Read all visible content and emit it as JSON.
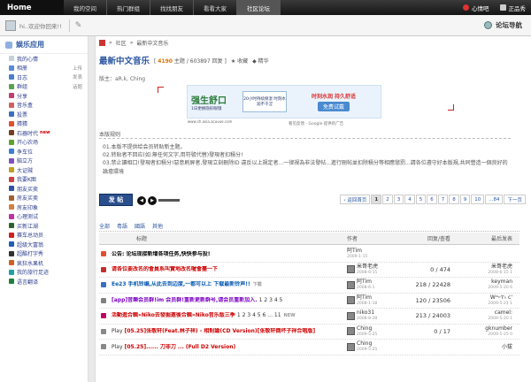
{
  "topnav": {
    "home": "Home",
    "items": [
      "我的空间",
      "热门群组",
      "找找朋友",
      "看看大家",
      "社区论坛"
    ],
    "active": 4,
    "right": [
      "心情吧",
      "正品秀"
    ]
  },
  "userbar": {
    "welcome": "hi..欢迎你回来!!",
    "forum_nav": "论坛导航"
  },
  "sidebar": {
    "title": "娱乐应用",
    "items": [
      {
        "label": "我的心情",
        "color": "#c5d0da"
      },
      {
        "label": "相册",
        "extra": "上传",
        "color": "#5b8bd5"
      },
      {
        "label": "日志",
        "extra": "发表",
        "color": "#4a7fc8"
      },
      {
        "label": "群组",
        "extra": "话题",
        "color": "#5aa050"
      },
      {
        "label": "分享",
        "color": "#c04070"
      },
      {
        "label": "音乐盒",
        "color": "#d06060"
      },
      {
        "label": "投票",
        "color": "#3a70c0"
      },
      {
        "label": "猜猜",
        "color": "#e05030"
      },
      {
        "label": "石器时代",
        "new": "new",
        "color": "#704020"
      },
      {
        "label": "开心农场",
        "color": "#60a030"
      },
      {
        "label": "争车位",
        "color": "#3a80d0"
      },
      {
        "label": "脑立方",
        "color": "#8050c0"
      },
      {
        "label": "大证贼",
        "color": "#c0a020"
      },
      {
        "label": "我要K图",
        "color": "#d04040"
      },
      {
        "label": "朋友买卖",
        "color": "#3050a0"
      },
      {
        "label": "房友买卖",
        "color": "#a06030"
      },
      {
        "label": "房友印象",
        "color": "#d08040"
      },
      {
        "label": "心理测试",
        "color": "#c030a0"
      },
      {
        "label": "买新江湖",
        "color": "#306030"
      },
      {
        "label": "赛车总动员",
        "color": "#d02020"
      },
      {
        "label": "超级大富翁",
        "color": "#2060b0"
      },
      {
        "label": "超酷打字秀",
        "color": "#303030"
      },
      {
        "label": "疯狂水果机",
        "color": "#d06020"
      },
      {
        "label": "我的旅行足迹",
        "color": "#20a0a0"
      },
      {
        "label": "语言翻译",
        "color": "#208040"
      }
    ]
  },
  "breadcrumb": {
    "a": "社区",
    "b": "最新中文音乐"
  },
  "forum": {
    "name": "最新中文音乐",
    "topics": "4190",
    "topics_label": "主题",
    "posts": "/ 603897 回复",
    "collect": "收藏",
    "digest": "精华",
    "moderators": "版主：aR.k, Ching"
  },
  "ad": {
    "brand": "强生舒口",
    "slogan": "1日更换隐形眼镜",
    "mid": "20小时持续保湿 时刻水润不干涩",
    "right1": "时刻水润 持久舒适",
    "right2": "免费试戴",
    "url": "www.ch.asia.acuvue.com",
    "by": "看见反馈 - Google 提供的广告"
  },
  "rules": {
    "heading": "本版规则",
    "lines": [
      "01.本版不提供给会员转贴新主题。",
      "02.转贴者不回应(如:無任何文字,用符號代替)發現者扣積分!",
      "03.禁止讀相口!發現者扣積分!惡意刷屏者,發現立刻刪除ID 違反以上規定者...一律視為非法發帖...進行刪帖並扣除積分等相應懲罰...請各位遵守好本版規,共同營造一個良好的論壇環境"
    ]
  },
  "post_button": "发 帖",
  "pager": {
    "prev": "‹ 返回首页",
    "pages": [
      "1",
      "2",
      "3",
      "4",
      "5",
      "6",
      "7",
      "8",
      "9",
      "10",
      "...84"
    ],
    "current": "1",
    "next": "下一页"
  },
  "filter_tabs": [
    "全部",
    "粤語",
    "國語",
    "其他"
  ],
  "table": {
    "headers": [
      "标题",
      "作者",
      "回复/查看",
      "最后发表"
    ],
    "rows": [
      {
        "title": "公告: 论坛现接新增各项任务,快快参与投!",
        "style": "t-announce",
        "author": "阿Tim",
        "adate": "2009-1-15",
        "stats": "",
        "last": "",
        "ldate": "",
        "icon": "#e05030",
        "av": false
      },
      {
        "title": "请各位要改名的會員系叫實地改名喔會盡一下",
        "style": "t-red",
        "author": "米哥老虎",
        "adate": "2008-6-15",
        "stats": "0 / 474",
        "last": "米哥老虎",
        "ldate": "2008-6-15 1",
        "icon": "#c03030",
        "av": true
      },
      {
        "title": "Ee23 手机铃编,从此去到边度,一都可以上",
        "title2": "下载最新铃声!!",
        "title3": "下载",
        "style": "t-blue",
        "author": "阿Tim",
        "adate": "2008-6-1",
        "stats": "218 / 22428",
        "last": "keyman",
        "ldate": "2009-5-20 6",
        "icon": "#3a70c0",
        "av": true
      },
      {
        "title": "[app]音樂会员群!im 会员群!重新更新群号,请会员重新加入.",
        "title2": "1 2 3 4 5",
        "style": "t-purple",
        "author": "阿Tim",
        "adate": "2008-1-18",
        "stats": "120 / 23506",
        "last": "W～т♭ c'",
        "ldate": "2009-5-21 1",
        "icon": "#808080",
        "av": true
      },
      {
        "title": "活動進合輯»Niko去發掘邀後合輯»Niko音乐版三季",
        "title2": "1 2 3 4 5 6 ... 11",
        "style": "t-red",
        "author": "niko31",
        "adate": "2008-8-28",
        "stats": "213 / 24003",
        "last": "camel:",
        "ldate": "2009-5-20 1",
        "icon": "#c00060",
        "av": true
      },
      {
        "title": "[05.25]张敬轩(Feat.林子祥) - 相對論(CD Version)[张敬轩倒坏子祥合唱版]",
        "style": "t-red",
        "prefix": "Play",
        "author": "Ching",
        "adate": "2009-5-25",
        "stats": "0 / 17",
        "last": "gknumber",
        "ldate": "2009-5-25 0",
        "icon": "#888888",
        "av": true
      },
      {
        "title": "[05.25]...... 刀非刀 ... (Full D2 Version)",
        "style": "t-red",
        "prefix": "Play",
        "author": "Ching",
        "adate": "2009-5-25",
        "stats": "",
        "last": "小拔",
        "ldate": "",
        "icon": "#888888",
        "av": true
      }
    ]
  }
}
